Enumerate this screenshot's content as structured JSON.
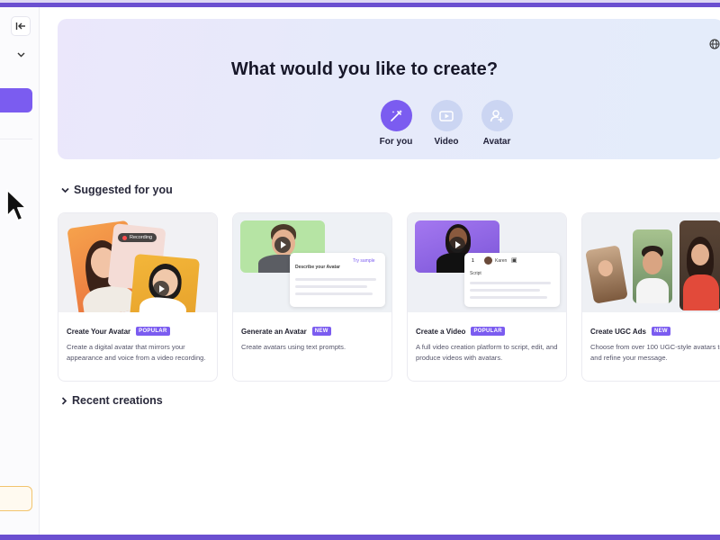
{
  "hero": {
    "title": "What would you like to create?",
    "modes": [
      {
        "label": "For you",
        "icon": "magic-wand-icon",
        "active": true
      },
      {
        "label": "Video",
        "icon": "video-icon",
        "active": false
      },
      {
        "label": "Avatar",
        "icon": "add-avatar-icon",
        "active": false
      }
    ]
  },
  "sections": {
    "suggested": "Suggested for you",
    "recent": "Recent creations"
  },
  "cards": [
    {
      "title": "Create Your Avatar",
      "badge": "POPULAR",
      "description": "Create a digital avatar that mirrors your appearance and voice from a video recording.",
      "media": {
        "recording_label": "Recording"
      }
    },
    {
      "title": "Generate an Avatar",
      "badge": "NEW",
      "description": "Create avatars using text prompts.",
      "media": {
        "panel_title": "Describe your Avatar",
        "try_label": "Try sample"
      }
    },
    {
      "title": "Create a Video",
      "badge": "POPULAR",
      "description": "A full video creation platform to script, edit, and produce videos with avatars.",
      "media": {
        "scene_number": "1",
        "avatar_name": "Karen",
        "script_label": "Script"
      }
    },
    {
      "title": "Create UGC Ads",
      "badge": "NEW",
      "description": "Choose from over 100 UGC-style avatars to test and refine your message.",
      "media": {}
    }
  ],
  "colors": {
    "accent": "#7b5cf0",
    "frame": "#6b4fd0",
    "mode_inactive": "#cbd5f2"
  }
}
